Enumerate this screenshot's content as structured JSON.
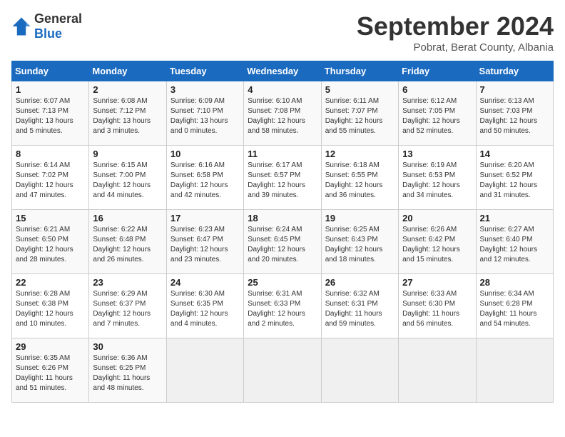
{
  "header": {
    "logo_general": "General",
    "logo_blue": "Blue",
    "month_title": "September 2024",
    "subtitle": "Pobrat, Berat County, Albania"
  },
  "days_of_week": [
    "Sunday",
    "Monday",
    "Tuesday",
    "Wednesday",
    "Thursday",
    "Friday",
    "Saturday"
  ],
  "weeks": [
    [
      {
        "day": "1",
        "lines": [
          "Sunrise: 6:07 AM",
          "Sunset: 7:13 PM",
          "Daylight: 13 hours",
          "and 5 minutes."
        ]
      },
      {
        "day": "2",
        "lines": [
          "Sunrise: 6:08 AM",
          "Sunset: 7:12 PM",
          "Daylight: 13 hours",
          "and 3 minutes."
        ]
      },
      {
        "day": "3",
        "lines": [
          "Sunrise: 6:09 AM",
          "Sunset: 7:10 PM",
          "Daylight: 13 hours",
          "and 0 minutes."
        ]
      },
      {
        "day": "4",
        "lines": [
          "Sunrise: 6:10 AM",
          "Sunset: 7:08 PM",
          "Daylight: 12 hours",
          "and 58 minutes."
        ]
      },
      {
        "day": "5",
        "lines": [
          "Sunrise: 6:11 AM",
          "Sunset: 7:07 PM",
          "Daylight: 12 hours",
          "and 55 minutes."
        ]
      },
      {
        "day": "6",
        "lines": [
          "Sunrise: 6:12 AM",
          "Sunset: 7:05 PM",
          "Daylight: 12 hours",
          "and 52 minutes."
        ]
      },
      {
        "day": "7",
        "lines": [
          "Sunrise: 6:13 AM",
          "Sunset: 7:03 PM",
          "Daylight: 12 hours",
          "and 50 minutes."
        ]
      }
    ],
    [
      {
        "day": "8",
        "lines": [
          "Sunrise: 6:14 AM",
          "Sunset: 7:02 PM",
          "Daylight: 12 hours",
          "and 47 minutes."
        ]
      },
      {
        "day": "9",
        "lines": [
          "Sunrise: 6:15 AM",
          "Sunset: 7:00 PM",
          "Daylight: 12 hours",
          "and 44 minutes."
        ]
      },
      {
        "day": "10",
        "lines": [
          "Sunrise: 6:16 AM",
          "Sunset: 6:58 PM",
          "Daylight: 12 hours",
          "and 42 minutes."
        ]
      },
      {
        "day": "11",
        "lines": [
          "Sunrise: 6:17 AM",
          "Sunset: 6:57 PM",
          "Daylight: 12 hours",
          "and 39 minutes."
        ]
      },
      {
        "day": "12",
        "lines": [
          "Sunrise: 6:18 AM",
          "Sunset: 6:55 PM",
          "Daylight: 12 hours",
          "and 36 minutes."
        ]
      },
      {
        "day": "13",
        "lines": [
          "Sunrise: 6:19 AM",
          "Sunset: 6:53 PM",
          "Daylight: 12 hours",
          "and 34 minutes."
        ]
      },
      {
        "day": "14",
        "lines": [
          "Sunrise: 6:20 AM",
          "Sunset: 6:52 PM",
          "Daylight: 12 hours",
          "and 31 minutes."
        ]
      }
    ],
    [
      {
        "day": "15",
        "lines": [
          "Sunrise: 6:21 AM",
          "Sunset: 6:50 PM",
          "Daylight: 12 hours",
          "and 28 minutes."
        ]
      },
      {
        "day": "16",
        "lines": [
          "Sunrise: 6:22 AM",
          "Sunset: 6:48 PM",
          "Daylight: 12 hours",
          "and 26 minutes."
        ]
      },
      {
        "day": "17",
        "lines": [
          "Sunrise: 6:23 AM",
          "Sunset: 6:47 PM",
          "Daylight: 12 hours",
          "and 23 minutes."
        ]
      },
      {
        "day": "18",
        "lines": [
          "Sunrise: 6:24 AM",
          "Sunset: 6:45 PM",
          "Daylight: 12 hours",
          "and 20 minutes."
        ]
      },
      {
        "day": "19",
        "lines": [
          "Sunrise: 6:25 AM",
          "Sunset: 6:43 PM",
          "Daylight: 12 hours",
          "and 18 minutes."
        ]
      },
      {
        "day": "20",
        "lines": [
          "Sunrise: 6:26 AM",
          "Sunset: 6:42 PM",
          "Daylight: 12 hours",
          "and 15 minutes."
        ]
      },
      {
        "day": "21",
        "lines": [
          "Sunrise: 6:27 AM",
          "Sunset: 6:40 PM",
          "Daylight: 12 hours",
          "and 12 minutes."
        ]
      }
    ],
    [
      {
        "day": "22",
        "lines": [
          "Sunrise: 6:28 AM",
          "Sunset: 6:38 PM",
          "Daylight: 12 hours",
          "and 10 minutes."
        ]
      },
      {
        "day": "23",
        "lines": [
          "Sunrise: 6:29 AM",
          "Sunset: 6:37 PM",
          "Daylight: 12 hours",
          "and 7 minutes."
        ]
      },
      {
        "day": "24",
        "lines": [
          "Sunrise: 6:30 AM",
          "Sunset: 6:35 PM",
          "Daylight: 12 hours",
          "and 4 minutes."
        ]
      },
      {
        "day": "25",
        "lines": [
          "Sunrise: 6:31 AM",
          "Sunset: 6:33 PM",
          "Daylight: 12 hours",
          "and 2 minutes."
        ]
      },
      {
        "day": "26",
        "lines": [
          "Sunrise: 6:32 AM",
          "Sunset: 6:31 PM",
          "Daylight: 11 hours",
          "and 59 minutes."
        ]
      },
      {
        "day": "27",
        "lines": [
          "Sunrise: 6:33 AM",
          "Sunset: 6:30 PM",
          "Daylight: 11 hours",
          "and 56 minutes."
        ]
      },
      {
        "day": "28",
        "lines": [
          "Sunrise: 6:34 AM",
          "Sunset: 6:28 PM",
          "Daylight: 11 hours",
          "and 54 minutes."
        ]
      }
    ],
    [
      {
        "day": "29",
        "lines": [
          "Sunrise: 6:35 AM",
          "Sunset: 6:26 PM",
          "Daylight: 11 hours",
          "and 51 minutes."
        ]
      },
      {
        "day": "30",
        "lines": [
          "Sunrise: 6:36 AM",
          "Sunset: 6:25 PM",
          "Daylight: 11 hours",
          "and 48 minutes."
        ]
      },
      {
        "day": "",
        "lines": []
      },
      {
        "day": "",
        "lines": []
      },
      {
        "day": "",
        "lines": []
      },
      {
        "day": "",
        "lines": []
      },
      {
        "day": "",
        "lines": []
      }
    ]
  ]
}
